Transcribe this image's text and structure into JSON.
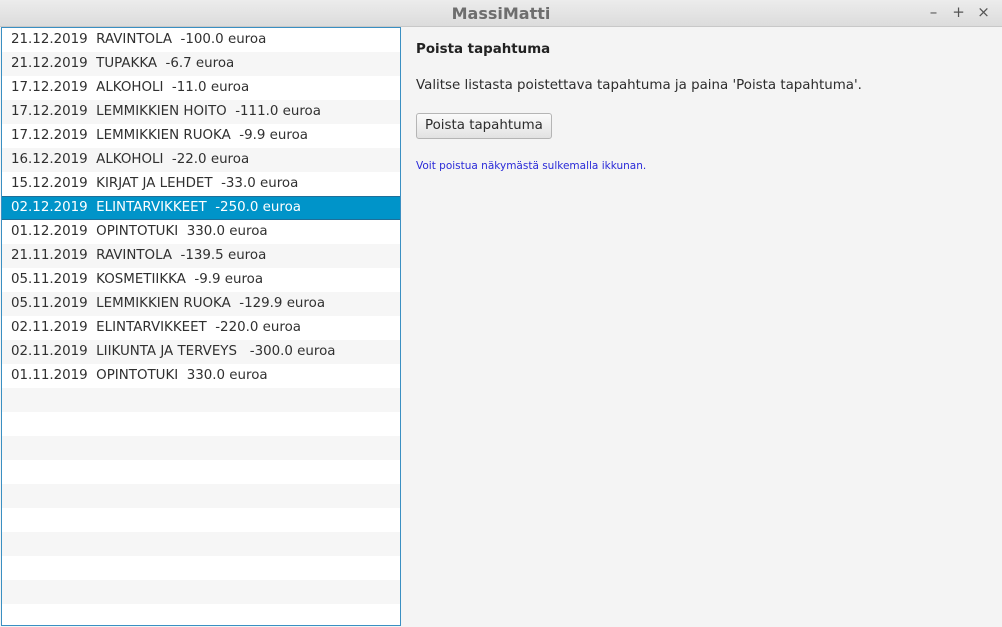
{
  "window": {
    "title": "MassiMatti",
    "controls": {
      "minimize": "–",
      "maximize": "+",
      "close": "×"
    }
  },
  "list": {
    "selected_index": 7,
    "items": [
      "21.12.2019  RAVINTOLA  -100.0 euroa",
      "21.12.2019  TUPAKKA  -6.7 euroa",
      "17.12.2019  ALKOHOLI  -11.0 euroa",
      "17.12.2019  LEMMIKKIEN HOITO  -111.0 euroa",
      "17.12.2019  LEMMIKKIEN RUOKA  -9.9 euroa",
      "16.12.2019  ALKOHOLI  -22.0 euroa",
      "15.12.2019  KIRJAT JA LEHDET  -33.0 euroa",
      "02.12.2019  ELINTARVIKKEET  -250.0 euroa",
      "01.12.2019  OPINTOTUKI  330.0 euroa",
      "21.11.2019  RAVINTOLA  -139.5 euroa",
      "05.11.2019  KOSMETIIKKA  -9.9 euroa",
      "05.11.2019  LEMMIKKIEN RUOKA  -129.9 euroa",
      "02.11.2019  ELINTARVIKKEET  -220.0 euroa",
      "02.11.2019  LIIKUNTA JA TERVEYS   -300.0 euroa",
      "01.11.2019  OPINTOTUKI  330.0 euroa"
    ]
  },
  "panel": {
    "heading": "Poista tapahtuma",
    "instruction": "Valitse listasta poistettava tapahtuma ja paina 'Poista tapahtuma'.",
    "button_label": "Poista tapahtuma",
    "hint": "Voit poistua näkymästä sulkemalla ikkunan."
  },
  "colors": {
    "selection": "#0094c9",
    "list_border": "#3a8fc2",
    "hint_text": "#2a2ad8"
  }
}
